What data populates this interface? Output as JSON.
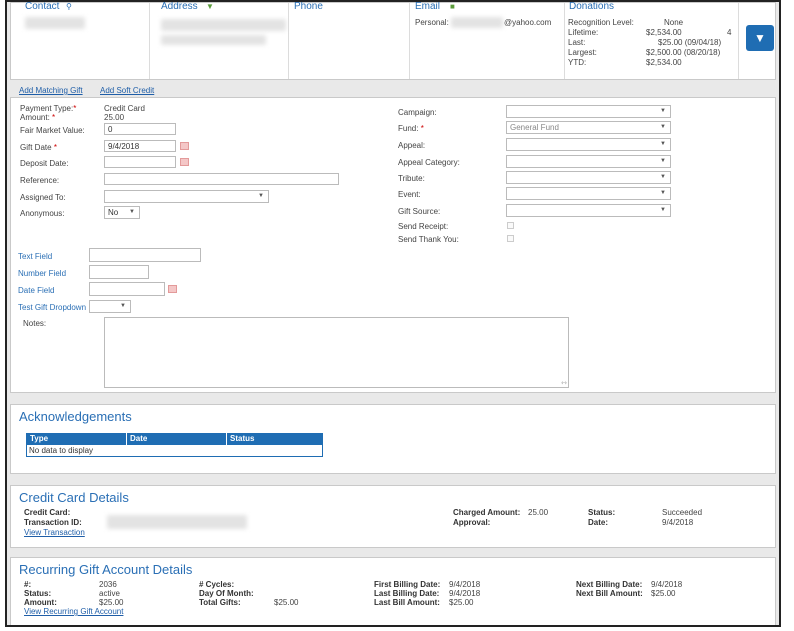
{
  "header": {
    "contact_label": "Contact",
    "address_label": "Address",
    "phone_label": "Phone",
    "email_label": "Email",
    "donations_label": "Donations",
    "personal_label": "Personal:",
    "email_domain": "@yahoo.com",
    "recognition_level_label": "Recognition Level:",
    "recognition_level_value": "None",
    "lifetime_label": "Lifetime:",
    "lifetime_value": "$2,534.00",
    "lifetime_count": "4",
    "last_label": "Last:",
    "last_value": "$25.00 (09/04/18)",
    "largest_label": "Largest:",
    "largest_value": "$2,500.00 (08/20/18)",
    "ytd_label": "YTD:",
    "ytd_value": "$2,534.00"
  },
  "links": {
    "add_matching_gift": "Add Matching Gift",
    "add_soft_credit": "Add Soft Credit"
  },
  "gift_form": {
    "payment_type_label": "Payment Type:",
    "payment_type_value": "Credit Card",
    "amount_label": "Amount:",
    "amount_value": "25.00",
    "fair_market_label": "Fair Market Value:",
    "fair_market_value": "0",
    "gift_date_label": "Gift Date",
    "gift_date_value": "9/4/2018",
    "deposit_date_label": "Deposit Date:",
    "reference_label": "Reference:",
    "assigned_to_label": "Assigned To:",
    "anonymous_label": "Anonymous:",
    "anonymous_value": "No",
    "campaign_label": "Campaign:",
    "fund_label": "Fund:",
    "fund_value": "General Fund",
    "appeal_label": "Appeal:",
    "appeal_category_label": "Appeal Category:",
    "tribute_label": "Tribute:",
    "event_label": "Event:",
    "gift_source_label": "Gift Source:",
    "send_receipt_label": "Send Receipt:",
    "send_thank_you_label": "Send Thank You:",
    "text_field_label": "Text Field",
    "number_field_label": "Number Field",
    "date_field_label": "Date Field",
    "test_gift_dropdown_label": "Test Gift Dropdown",
    "notes_label": "Notes:"
  },
  "acknowledgements": {
    "title": "Acknowledgements",
    "columns": [
      "Type",
      "Date",
      "Status"
    ],
    "empty_text": "No data to display"
  },
  "credit_card": {
    "title": "Credit Card Details",
    "credit_card_label": "Credit Card:",
    "transaction_id_label": "Transaction ID:",
    "view_transaction": "View Transaction",
    "charged_amount_label": "Charged Amount:",
    "charged_amount_value": "25.00",
    "approval_label": "Approval:",
    "status_label": "Status:",
    "status_value": "Succeeded",
    "date_label": "Date:",
    "date_value": "9/4/2018"
  },
  "recurring": {
    "title": "Recurring Gift Account Details",
    "number_label": "#:",
    "number_value": "2036",
    "status_label": "Status:",
    "status_value": "active",
    "amount_label": "Amount:",
    "amount_value": "$25.00",
    "view_account": "View Recurring Gift Account",
    "cycles_label": "# Cycles:",
    "day_of_month_label": "Day Of Month:",
    "total_gifts_label": "Total Gifts:",
    "total_gifts_value": "$25.00",
    "first_billing_label": "First Billing Date:",
    "first_billing_value": "9/4/2018",
    "last_billing_label": "Last Billing Date:",
    "last_billing_value": "9/4/2018",
    "last_bill_amount_label": "Last Bill Amount:",
    "last_bill_amount_value": "$25.00",
    "next_billing_label": "Next Billing Date:",
    "next_billing_value": "9/4/2018",
    "next_bill_amount_label": "Next Bill Amount:",
    "next_bill_amount_value": "$25.00"
  },
  "colors": {
    "accent": "#1f6db3",
    "link": "#1f5ea8",
    "required": "#cc0000"
  }
}
